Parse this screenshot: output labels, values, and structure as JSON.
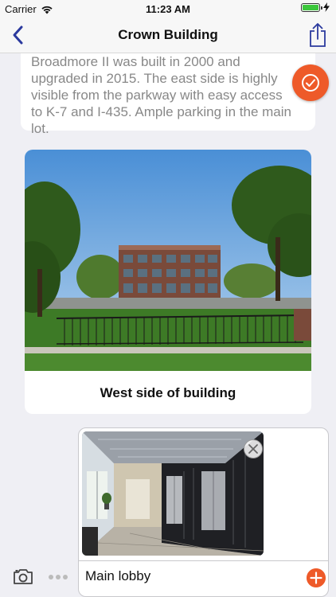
{
  "status_bar": {
    "carrier": "Carrier",
    "time": "11:23 AM",
    "battery_level": 1.0,
    "battery_color": "#3cc73c"
  },
  "nav": {
    "title": "Crown Building",
    "back_icon": "chevron-left-icon",
    "share_icon": "share-icon",
    "accent": "#2b3a9e"
  },
  "description": {
    "lines": [
      "Broadmore II was built in 2000 and",
      "upgraded in 2015. The east side is highly",
      "visible from the parkway with easy access",
      "to K-7 and I-435. Ample parking in the main",
      "lot."
    ]
  },
  "photo_card": {
    "caption": "West side of building"
  },
  "new_entry": {
    "text": "Main lobby"
  },
  "colors": {
    "fab": "#ee5a29",
    "background": "#efeff4"
  }
}
